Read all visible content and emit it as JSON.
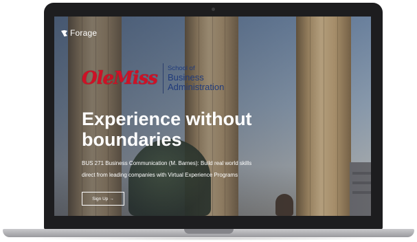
{
  "brand": {
    "name": "Forage",
    "icon": "forage-leaf-icon"
  },
  "school": {
    "logo_text": "OleMiss",
    "line1": "School of",
    "line2": "Business",
    "line3": "Administration",
    "logo_color": "#ce1126",
    "text_color": "#1f3a7a"
  },
  "hero": {
    "headline_line1": "Experience without",
    "headline_line2": "boundaries",
    "description_line1": "BUS 271 Business Communication (M. Barnes): Build real world skills",
    "description_line2": "direct from leading companies with Virtual Experience Programs",
    "cta_label": "Sign Up →"
  }
}
